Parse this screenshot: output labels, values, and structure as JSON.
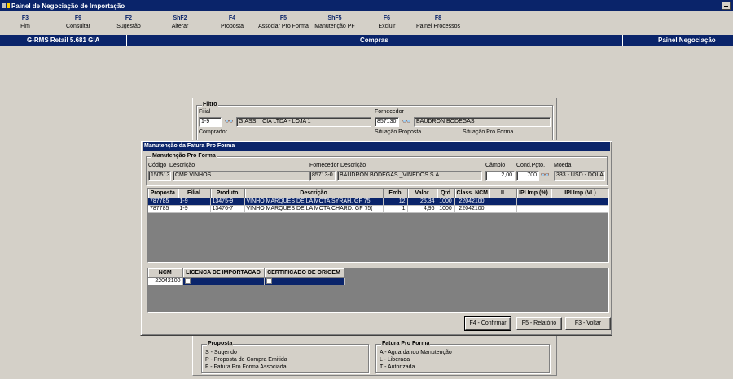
{
  "window": {
    "title": "Painel de Negociação de Importação"
  },
  "toolbar": {
    "keys": [
      {
        "key": "F3",
        "label": "Fim"
      },
      {
        "key": "F9",
        "label": "Consultar"
      },
      {
        "key": "F2",
        "label": "Sugestão"
      },
      {
        "key": "ShF2",
        "label": "Alterar"
      },
      {
        "key": "F4",
        "label": "Proposta"
      },
      {
        "key": "F5",
        "label": "Associar Pro Forma"
      },
      {
        "key": "ShF5",
        "label": "Manutenção PF"
      },
      {
        "key": "F6",
        "label": "Excluir"
      },
      {
        "key": "F8",
        "label": "Painel Processos"
      }
    ]
  },
  "band": {
    "left": "G-RMS Retail 5.681 GIA",
    "center": "Compras",
    "right": "Painel Negociação"
  },
  "filtro": {
    "title": "Filtro",
    "filial_label": "Filial",
    "filial_code": "1-9",
    "filial_name": "GIASSI _CIA LTDA - LOJA 1",
    "fornecedor_label": "Fornecedor",
    "fornecedor_code": "857130",
    "fornecedor_name": "BAUDRON BODEGAS",
    "comprador_label": "Comprador",
    "situacao_proposta_label": "Situação Proposta",
    "situacao_pf_label": "Situação Pro Forma"
  },
  "dialog": {
    "title": "Manutenção da Fatura Pro Forma",
    "group_title": "Manutenção Pro Forma",
    "codigo_label": "Código",
    "descricao_label": "Descrição",
    "fornecedor_label": "Fornecedor",
    "fornecedor_desc_label": "Descrição",
    "cambio_label": "Câmbio",
    "cond_label": "Cond.Pgto.",
    "moeda_label": "Moeda",
    "codigo": "150513",
    "descricao": "CMP VINHOS",
    "fornecedor": "85713-0",
    "fornecedor_desc": "BAUDRON BODEGAS _VINEDOS S.A",
    "cambio": "2,00",
    "cond": "700",
    "moeda": "333 - USD - DOLAR",
    "columns": [
      "Proposta",
      "Filial",
      "Produto",
      "Descrição",
      "Emb",
      "Valor",
      "Qtd",
      "Class. NCM",
      "II",
      "IPI Imp (%)",
      "IPI Imp (VL)"
    ],
    "rows": [
      {
        "proposta": "787785",
        "filial": "1-9",
        "produto": "13475-9",
        "descricao": "VINHO MARQUES DE LA MOTA SYRAH. GF 75",
        "emb": "12",
        "valor": "25,34",
        "qtd": "1000",
        "ncm": "22042100",
        "ii": "",
        "ipi_pct": "",
        "ipi_vl": ""
      },
      {
        "proposta": "787785",
        "filial": "1-9",
        "produto": "13476-7",
        "descricao": "VINHO MARQUES DE LA MOTA CHARD. GF 75(",
        "emb": "1",
        "valor": "4,96",
        "qtd": "1000",
        "ncm": "22042100",
        "ii": "",
        "ipi_pct": "",
        "ipi_vl": ""
      }
    ],
    "ncm_columns": [
      "NCM",
      "LICENCA DE IMPORTACAO",
      "CERTIFICADO DE ORIGEM"
    ],
    "ncm_rows": [
      {
        "ncm": "22042100"
      }
    ],
    "buttons": {
      "confirmar": "F4 - Confirmar",
      "relatorio": "F5 - Relatório",
      "voltar": "F3 - Voltar"
    }
  },
  "legend": {
    "proposta_title": "Proposta",
    "proposta_items": [
      "S - Sugerido",
      "P - Proposta de Compra Emitida",
      "F - Fatura Pro Forma Associada"
    ],
    "fatura_title": "Fatura Pro Forma",
    "fatura_items": [
      "A - Aguardando Manutenção",
      "L - Liberada",
      "T - Autorizada"
    ]
  },
  "colors": {
    "titlebar": "#0a246a",
    "face": "#d4d0c8",
    "selection": "#0a246a"
  }
}
